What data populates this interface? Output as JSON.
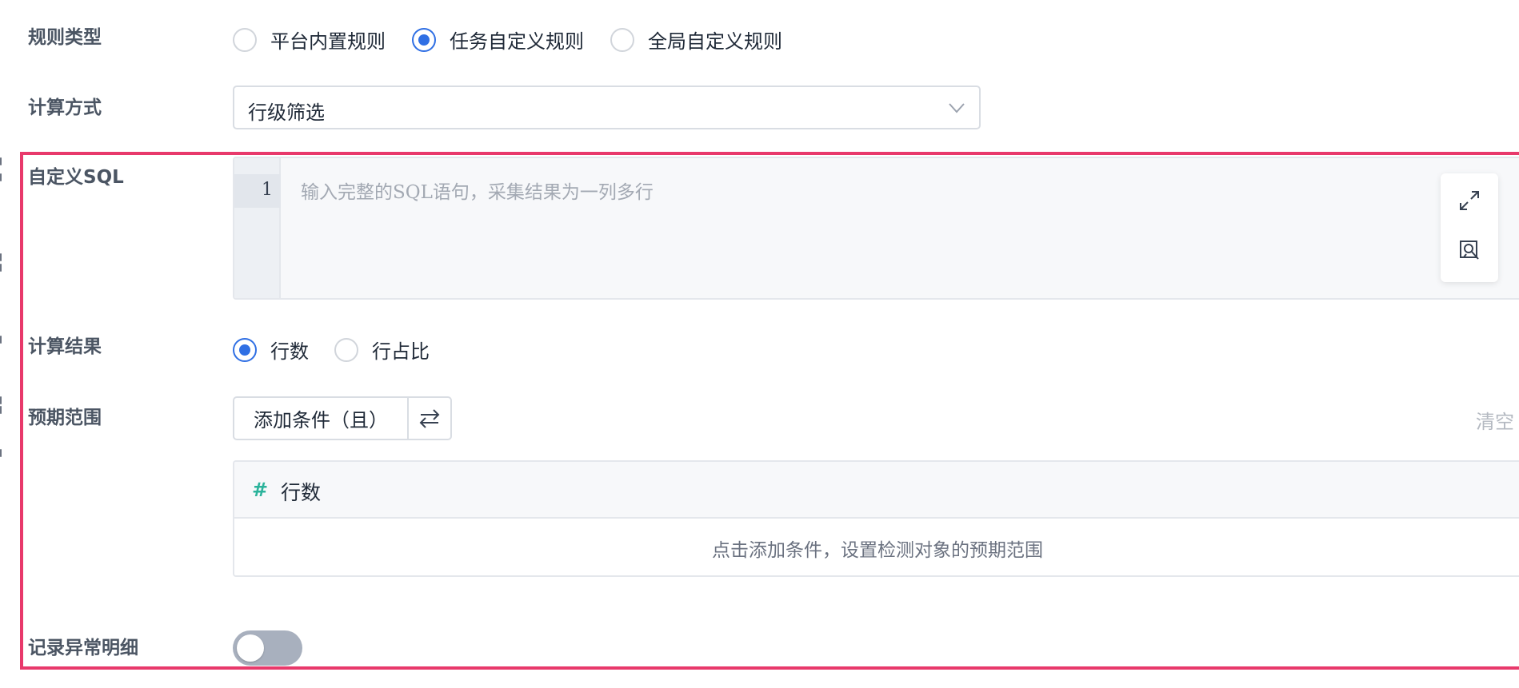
{
  "form": {
    "rule_type": {
      "label": "规则类型",
      "options": [
        {
          "label": "平台内置规则",
          "selected": false
        },
        {
          "label": "任务自定义规则",
          "selected": true
        },
        {
          "label": "全局自定义规则",
          "selected": false
        }
      ]
    },
    "calc_method": {
      "label": "计算方式",
      "value": "行级筛选",
      "icon": "chevron-down-icon"
    },
    "custom_sql": {
      "label": "自定义SQL",
      "line_number": "1",
      "placeholder": "输入完整的SQL语句，采集结果为一列多行",
      "tools": [
        "expand-icon",
        "preview-icon"
      ]
    },
    "calc_result": {
      "label": "计算结果",
      "options": [
        {
          "label": "行数",
          "selected": true
        },
        {
          "label": "行占比",
          "selected": false
        }
      ]
    },
    "expected_range": {
      "label": "预期范围",
      "add_condition": "添加条件（且）",
      "swap_icon": "swap-icon",
      "clear": "清空",
      "metric_hash": "#",
      "metric_name": "行数",
      "empty_hint": "点击添加条件，设置检测对象的预期范围"
    },
    "record_detail": {
      "label": "记录异常明细",
      "enabled": false
    }
  },
  "colors": {
    "accent": "#2f6fe4",
    "highlight_border": "#e8396b",
    "hash_green": "#2bb39b",
    "toggle_off": "#a8b0be"
  }
}
